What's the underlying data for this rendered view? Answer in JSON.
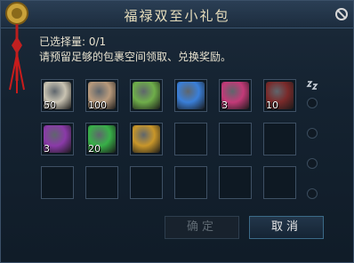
{
  "dialog": {
    "title": "福禄双至小礼包",
    "selected_label": "已选择量:",
    "selected_value": "0/1",
    "hint": "请预留足够的包裹空间领取、兑换奖励。",
    "confirm_label": "确定",
    "cancel_label": "取消"
  },
  "items": [
    {
      "icon": "scroll-figure-icon",
      "count": "50",
      "color": "#c9c3b2"
    },
    {
      "icon": "coin-pile-icon",
      "count": "100",
      "color": "#b89a7c"
    },
    {
      "icon": "green-orb-box-icon",
      "count": "",
      "color": "#6fae4a"
    },
    {
      "icon": "blue-orb-icon",
      "count": "",
      "color": "#3a7fd8"
    },
    {
      "icon": "pink-book-icon",
      "count": "3",
      "color": "#c33a78"
    },
    {
      "icon": "red-chest-icon",
      "count": "10",
      "color": "#7a2a2a"
    },
    {
      "icon": "purple-chest-icon",
      "count": "3",
      "color": "#8a3aa8"
    },
    {
      "icon": "green-pearl-icon",
      "count": "20",
      "color": "#38b048"
    },
    {
      "icon": "golden-medallion-icon",
      "count": "",
      "color": "#c8962a"
    }
  ],
  "empty_slots": 9
}
